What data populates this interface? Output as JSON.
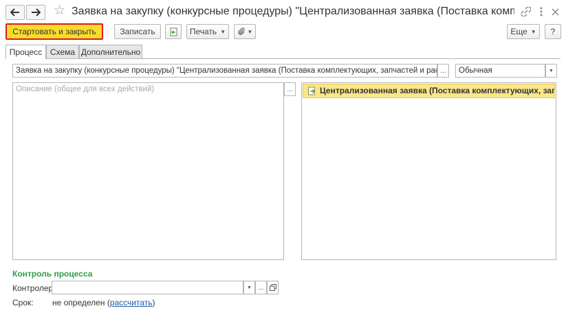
{
  "window": {
    "title": "Заявка на закупку (конкурсные процедуры) \"Централизованная заявка (Поставка комплектующих, запчастей и расходных материалов)\""
  },
  "toolbar": {
    "start_close_label": "Стартовать и закрыть",
    "save_label": "Записать",
    "print_label": "Печать",
    "more_label": "Еще",
    "help_label": "?"
  },
  "tabs": [
    {
      "label": "Процесс",
      "active": true
    },
    {
      "label": "Схема",
      "active": false
    },
    {
      "label": "Дополнительно",
      "active": false
    }
  ],
  "form": {
    "name_value": "Заявка на закупку (конкурсные процедуры) \"Централизованная заявка (Поставка комплектующих, запчастей и расходных материалов)\"",
    "importance_value": "Обычная",
    "description_placeholder": "Описание (общее для всех действий)",
    "tree_item_label": "Централизованная заявка (Поставка комплектующих, запчастей и расходных материалов)"
  },
  "control": {
    "section_title": "Контроль процесса",
    "controller_label": "Контролер:",
    "controller_value": "",
    "deadline_label": "Срок:",
    "deadline_value": "не определен",
    "deadline_paren_open": "(",
    "deadline_link": "рассчитать",
    "deadline_paren_close": ")"
  },
  "colors": {
    "primary_button": "#f9dc2c",
    "primary_border": "#e01b1b",
    "selected_row": "#fae78a",
    "section_title": "#2f9e44",
    "link": "#1f58a8"
  }
}
